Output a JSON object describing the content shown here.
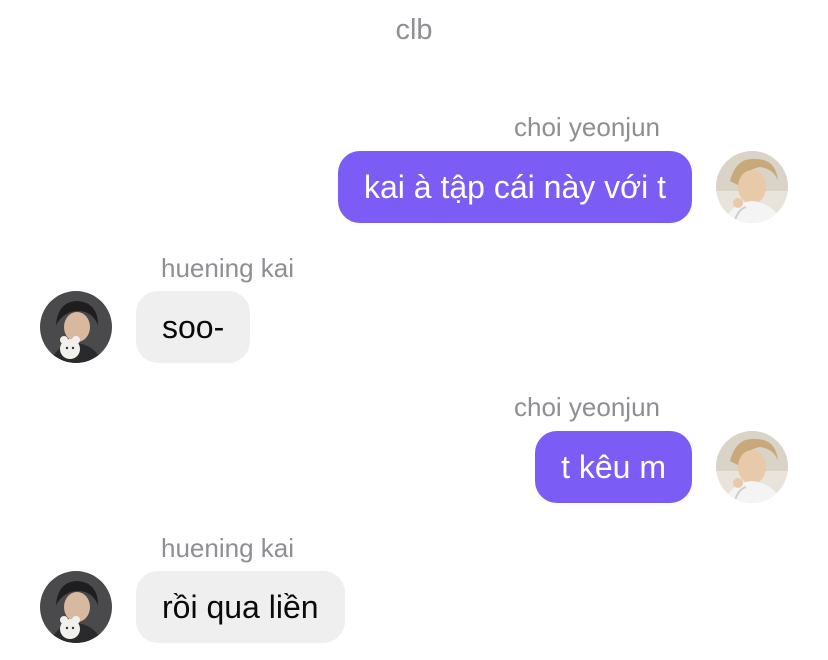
{
  "chat": {
    "title": "clb"
  },
  "messages": [
    {
      "sender": "choi yeonjun",
      "text": "kai à tập cái này với t",
      "direction": "outgoing",
      "avatar": "avatar-yeonjun"
    },
    {
      "sender": "huening kai",
      "text": "soo-",
      "direction": "incoming",
      "avatar": "avatar-hueningkai"
    },
    {
      "sender": "choi yeonjun",
      "text": "t kêu m",
      "direction": "outgoing",
      "avatar": "avatar-yeonjun"
    },
    {
      "sender": "huening kai",
      "text": "rồi qua liền",
      "direction": "incoming",
      "avatar": "avatar-hueningkai"
    }
  ],
  "colors": {
    "outgoing_bubble": "#7b5cf5",
    "incoming_bubble": "#efeff0",
    "name_gray": "#8e8e93"
  }
}
